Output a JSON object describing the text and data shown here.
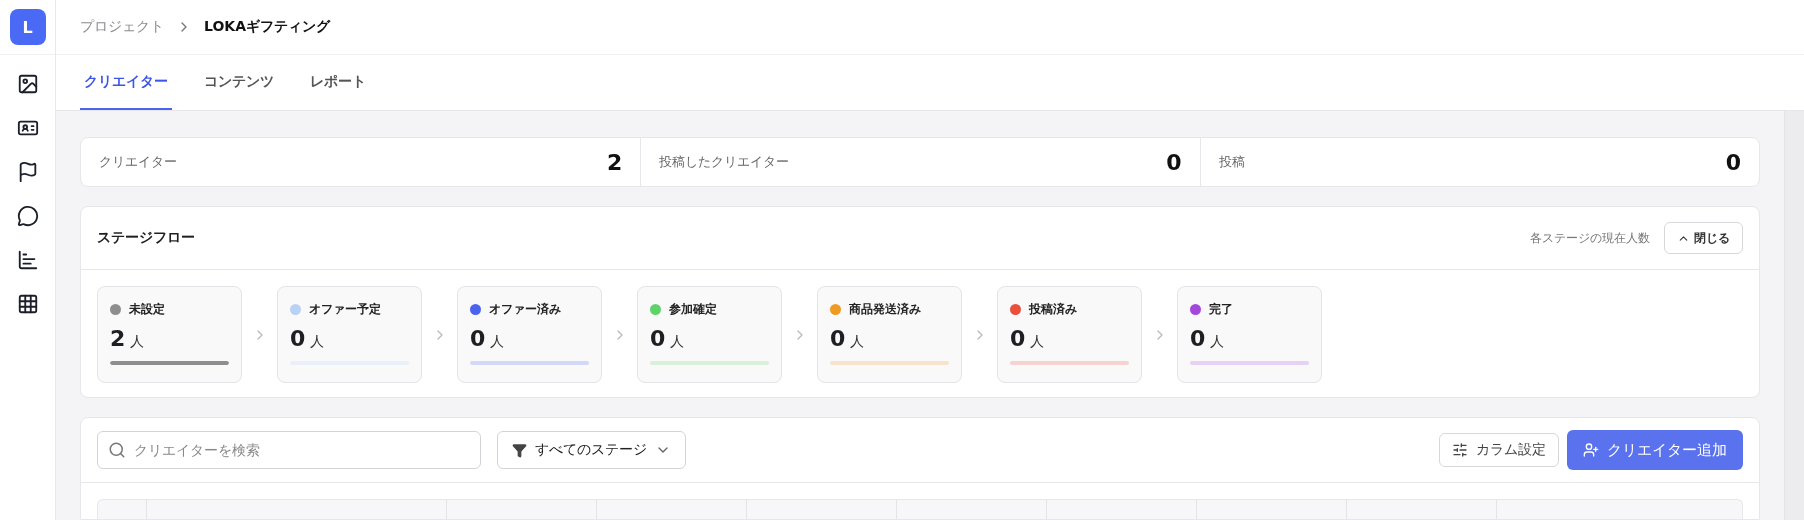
{
  "sidebar": {
    "logo": "L"
  },
  "breadcrumb": [
    {
      "label": "プロジェクト",
      "current": false
    },
    {
      "label": "LOKAギフティング",
      "current": true
    }
  ],
  "tabs": [
    {
      "label": "クリエイター",
      "selected": true
    },
    {
      "label": "コンテンツ",
      "selected": false
    },
    {
      "label": "レポート",
      "selected": false
    }
  ],
  "stats": [
    {
      "label": "クリエイター",
      "value": "2"
    },
    {
      "label": "投稿したクリエイター",
      "value": "0"
    },
    {
      "label": "投稿",
      "value": "0"
    }
  ],
  "stage_flow": {
    "title": "ステージフロー",
    "note": "各ステージの現在人数",
    "collapse_button": "閉じる",
    "stages": [
      {
        "name": "未設定",
        "count": "2",
        "unit": "人",
        "color": "#8e8e8e",
        "level": 1
      },
      {
        "name": "オファー予定",
        "count": "0",
        "unit": "人",
        "color": "#b8d2f6",
        "level": 0
      },
      {
        "name": "オファー済み",
        "count": "0",
        "unit": "人",
        "color": "#4a63f0",
        "level": 0
      },
      {
        "name": "参加確定",
        "count": "0",
        "unit": "人",
        "color": "#5fd36a",
        "level": 0
      },
      {
        "name": "商品発送済み",
        "count": "0",
        "unit": "人",
        "color": "#f09a20",
        "level": 0
      },
      {
        "name": "投稿済み",
        "count": "0",
        "unit": "人",
        "color": "#ec4f3a",
        "level": 0
      },
      {
        "name": "完了",
        "count": "0",
        "unit": "人",
        "color": "#a447df",
        "level": 0
      }
    ]
  },
  "toolbar": {
    "search": {
      "placeholder": "クリエイターを検索"
    },
    "stage_filter": "すべてのステージ",
    "column_settings": "カラム設定",
    "add_button": "クリエイター追加"
  }
}
